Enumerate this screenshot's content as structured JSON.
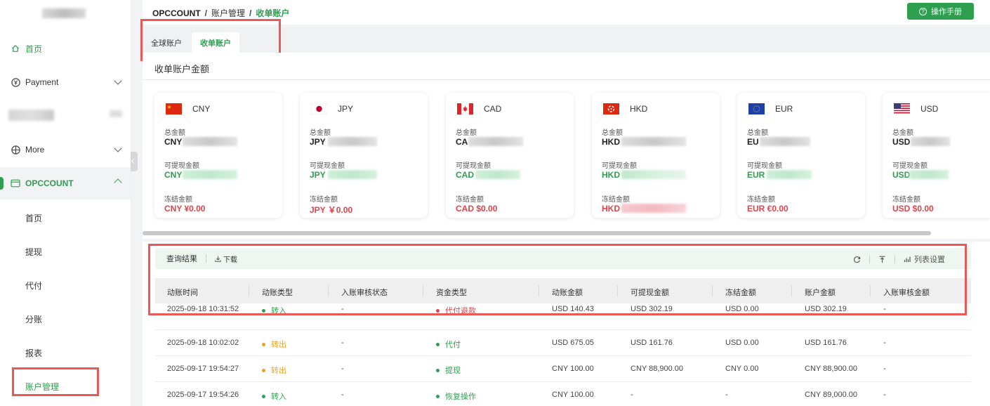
{
  "sidebar": {
    "items": [
      {
        "label": "首页",
        "icon": "home-icon"
      },
      {
        "label": "Payment",
        "icon": "yen-circle-icon"
      },
      {
        "label": "More",
        "icon": "grid-icon"
      },
      {
        "label": "OPCCOUNT",
        "icon": "wallet-icon"
      }
    ],
    "sub_items": [
      "首页",
      "提现",
      "代付",
      "分账",
      "报表",
      "账户管理"
    ]
  },
  "header": {
    "breadcrumb": [
      "OPCCOUNT",
      "账户管理",
      "收单账户"
    ],
    "breadcrumb_sep": "/",
    "manual_button": "操作手册"
  },
  "tabs": [
    {
      "label": "全球账户",
      "active": false
    },
    {
      "label": "收单账户",
      "active": true
    }
  ],
  "amount_section": {
    "title": "收单账户金额",
    "labels": {
      "total": "总金额",
      "withdrawable": "可提现金额",
      "frozen": "冻结金额"
    },
    "cards": [
      {
        "currency": "CNY",
        "total_prefix": "CNY",
        "withdraw_prefix": "CNY",
        "frozen": "CNY ¥0.00",
        "flag": "cn"
      },
      {
        "currency": "JPY",
        "total_prefix": "JPY",
        "withdraw_prefix": "JPY",
        "frozen": "JPY ￥0.00",
        "flag": "jp"
      },
      {
        "currency": "CAD",
        "total_prefix": "CA",
        "withdraw_prefix": "CAD",
        "frozen": "CAD $0.00",
        "flag": "ca"
      },
      {
        "currency": "HKD",
        "total_prefix": "HKD",
        "withdraw_prefix": "HKD",
        "frozen": "HKD",
        "flag": "hk"
      },
      {
        "currency": "EUR",
        "total_prefix": "EU",
        "withdraw_prefix": "EUR",
        "frozen": "EUR €0.00",
        "flag": "eu"
      },
      {
        "currency": "USD",
        "total_prefix": "USD",
        "withdraw_prefix": "USD",
        "frozen": "USD $0.00",
        "flag": "us"
      }
    ]
  },
  "table": {
    "toolbar": {
      "title": "查询结果",
      "download": "下载",
      "column_settings": "列表设置"
    },
    "columns": [
      "动账时间",
      "动账类型",
      "入账审核状态",
      "资金类型",
      "动账金额",
      "可提现金额",
      "冻结金额",
      "账户金额",
      "入账审核金额"
    ],
    "rows": [
      {
        "time": "2025-09-18 10:31:52",
        "type": "转入",
        "type_color": "#2e9e4f",
        "audit": "-",
        "fund": "代付退款",
        "fund_color": "#e0434a",
        "amount": "USD 140.43",
        "withdrawable": "USD 302.19",
        "frozen": "USD 0.00",
        "account": "USD 302.19",
        "audit_amount": "-"
      },
      {
        "time": "2025-09-18 10:02:02",
        "type": "转出",
        "type_color": "#f0a020",
        "audit": "-",
        "fund": "代付",
        "fund_color": "#2e9e4f",
        "amount": "USD 675.05",
        "withdrawable": "USD 161.76",
        "frozen": "USD 0.00",
        "account": "USD 161.76",
        "audit_amount": "-"
      },
      {
        "time": "2025-09-17 19:54:27",
        "type": "转出",
        "type_color": "#f0a020",
        "audit": "-",
        "fund": "提现",
        "fund_color": "#2e9e4f",
        "amount": "CNY 100.00",
        "withdrawable": "CNY 88,900.00",
        "frozen": "CNY 0.00",
        "account": "CNY 88,900.00",
        "audit_amount": "-"
      },
      {
        "time": "2025-09-17 19:54:26",
        "type": "转入",
        "type_color": "#2e9e4f",
        "audit": "-",
        "fund": "恢复操作",
        "fund_color": "#2e9e4f",
        "amount": "CNY 100.00",
        "withdrawable": "-",
        "frozen": "-",
        "account": "CNY 89,000.00",
        "audit_amount": "-"
      }
    ]
  },
  "colors": {
    "brand": "#2e9e4f",
    "danger": "#e0434a",
    "warning": "#f0a020",
    "highlight": "#e85a5a"
  }
}
